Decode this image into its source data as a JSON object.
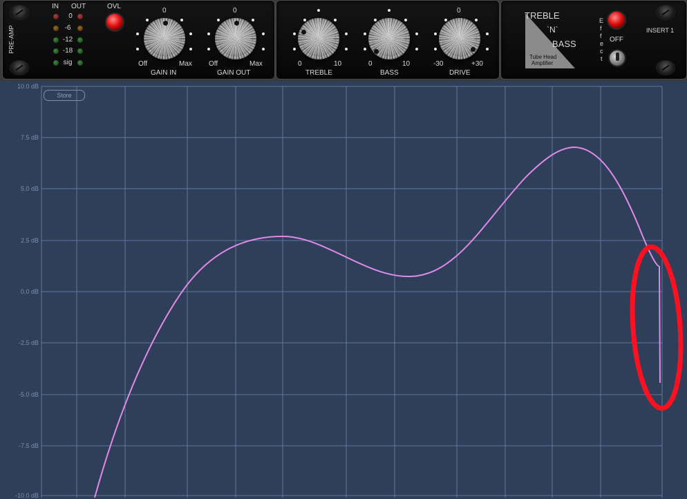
{
  "preamp": {
    "title": "PRE-AMP",
    "in_label": "IN",
    "out_label": "OUT",
    "levels": [
      "0",
      "-6",
      "-12",
      "-18",
      "sig"
    ],
    "ovl_label": "OVL",
    "gain_in": {
      "zero": "0",
      "min": "Off",
      "max": "Max",
      "name": "GAIN IN"
    },
    "gain_out": {
      "zero": "0",
      "min": "Off",
      "max": "Max",
      "name": "GAIN OUT"
    }
  },
  "tone": {
    "treble": {
      "min": "0",
      "max": "10",
      "name": "TREBLE"
    },
    "bass": {
      "min": "0",
      "max": "10",
      "name": "BASS"
    },
    "drive": {
      "zero": "0",
      "min": "-30",
      "max": "+30",
      "name": "DRIVE"
    }
  },
  "brand": {
    "line1": "TREBLE",
    "line2": "`N`",
    "line3": "BASS",
    "sub1": "Tube Head",
    "sub2": "Amplifier",
    "effect_letters": [
      "E",
      "f",
      "f",
      "e",
      "c",
      "t"
    ],
    "off_label": "OFF",
    "insert_label": "INSERT 1"
  },
  "graph": {
    "store_label": "Store",
    "y_labels": [
      "10.0 dB",
      "7.5 dB",
      "5.0 dB",
      "2.5 dB",
      "0.0 dB",
      "-2.5 dB",
      "-5.0 dB",
      "-7.5 dB",
      "-10.0 dB"
    ],
    "curve_color": "#e08ae8",
    "annotation_color": "#ff1020",
    "grid_color": "#5f7aa0"
  }
}
